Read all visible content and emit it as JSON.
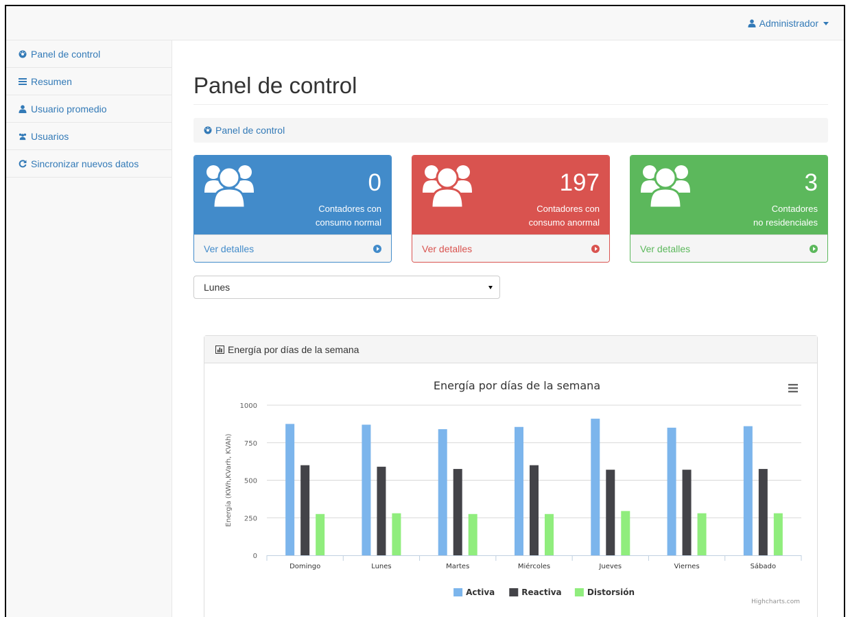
{
  "topbar": {
    "user_label": "Administrador"
  },
  "sidebar": {
    "items": [
      {
        "label": "Panel de control",
        "icon": "dashboard-icon"
      },
      {
        "label": "Resumen",
        "icon": "list-icon"
      },
      {
        "label": "Usuario promedio",
        "icon": "user-icon"
      },
      {
        "label": "Usuarios",
        "icon": "users-icon"
      },
      {
        "label": "Sincronizar nuevos datos",
        "icon": "refresh-icon"
      }
    ]
  },
  "page": {
    "title": "Panel de control",
    "breadcrumb": "Panel de control"
  },
  "cards": [
    {
      "count": "0",
      "line1": "Contadores con",
      "line2": "consumo normal",
      "link": "Ver detalles",
      "color": "#428bca"
    },
    {
      "count": "197",
      "line1": "Contadores con",
      "line2": "consumo anormal",
      "link": "Ver detalles",
      "color": "#d9534f"
    },
    {
      "count": "3",
      "line1": "Contadores",
      "line2": "no residenciales",
      "link": "Ver detalles",
      "color": "#5cb85c"
    }
  ],
  "day_select": {
    "selected": "Lunes"
  },
  "panel": {
    "heading": "Energía por días de la semana"
  },
  "chart_data": {
    "type": "bar",
    "title": "Energía por días de la semana",
    "ylabel": "Energía (KWh,KVarh, KVAh)",
    "xlabel": "",
    "ylim": [
      0,
      1000
    ],
    "yticks": [
      0,
      250,
      500,
      750,
      1000
    ],
    "categories": [
      "Domingo",
      "Lunes",
      "Martes",
      "Miércoles",
      "Jueves",
      "Viernes",
      "Sábado"
    ],
    "series": [
      {
        "name": "Activa",
        "color": "#7cb5ec",
        "values": [
          875,
          870,
          840,
          855,
          910,
          850,
          860
        ]
      },
      {
        "name": "Reactiva",
        "color": "#434348",
        "values": [
          600,
          590,
          575,
          600,
          570,
          570,
          575
        ]
      },
      {
        "name": "Distorsión",
        "color": "#90ed7d",
        "values": [
          275,
          280,
          275,
          275,
          295,
          280,
          280
        ]
      }
    ],
    "legend_position": "bottom-center",
    "credits": "Highcharts.com",
    "grid": true
  }
}
